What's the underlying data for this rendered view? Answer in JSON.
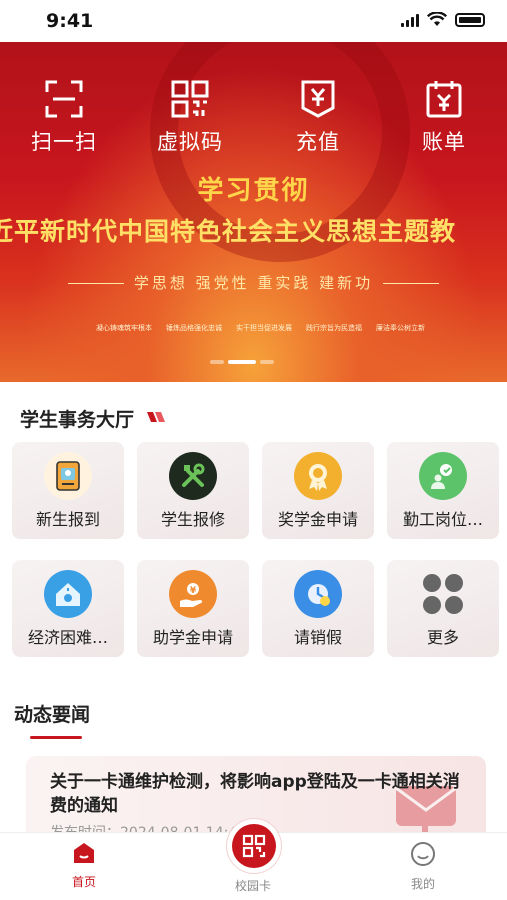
{
  "status_bar": {
    "time": "9:41"
  },
  "banner": {
    "quick_actions": [
      {
        "label": "扫一扫",
        "icon": "scan-icon"
      },
      {
        "label": "虚拟码",
        "icon": "qr-code-icon"
      },
      {
        "label": "充值",
        "icon": "recharge-icon"
      },
      {
        "label": "账单",
        "icon": "bill-icon"
      }
    ],
    "title": "学习贯彻",
    "subtitle": "近平新时代中国特色社会主义思想主题教",
    "slogan": "学思想  强党性  重实践  建新功",
    "tags": [
      "凝心铸魂筑牢根本",
      "锤炼品格强化忠诚",
      "实干担当促进发展",
      "践行宗旨为民造福",
      "廉洁奉公树立新"
    ],
    "carousel": {
      "pages": 3,
      "active_index": 1
    }
  },
  "services": {
    "title": "学生事务大厅",
    "items": [
      {
        "label": "新生报到",
        "icon": "id-card-icon",
        "color": "#f0a63a"
      },
      {
        "label": "学生报修",
        "icon": "repair-tools-icon",
        "color": "#1f2a1f"
      },
      {
        "label": "奖学金申请",
        "icon": "award-medal-icon",
        "color": "#f2b02e"
      },
      {
        "label": "勤工岗位…",
        "icon": "work-study-icon",
        "color": "#5cc36a"
      },
      {
        "label": "经济困难…",
        "icon": "home-aid-icon",
        "color": "#3aa0e6"
      },
      {
        "label": "助学金申请",
        "icon": "grant-hand-icon",
        "color": "#f08a2e"
      },
      {
        "label": "请销假",
        "icon": "leave-request-icon",
        "color": "#3a8ee6"
      },
      {
        "label": "更多",
        "icon": "more-grid-icon",
        "color": "#666666"
      }
    ]
  },
  "news": {
    "title": "动态要闻",
    "items": [
      {
        "headline": "关于一卡通维护检测，将影响app登陆及一卡通相关消费的通知",
        "date": "发布时间：2024-08-01 14:4"
      }
    ]
  },
  "tabbar": {
    "tabs": [
      {
        "label": "首页",
        "icon": "home-icon",
        "active": true
      },
      {
        "label": "校园卡",
        "icon": "campus-card-qr-icon",
        "active": false
      },
      {
        "label": "我的",
        "icon": "smiley-profile-icon",
        "active": false
      }
    ]
  },
  "colors": {
    "brand": "#c8161e",
    "accent_gold": "#ffd54a"
  }
}
